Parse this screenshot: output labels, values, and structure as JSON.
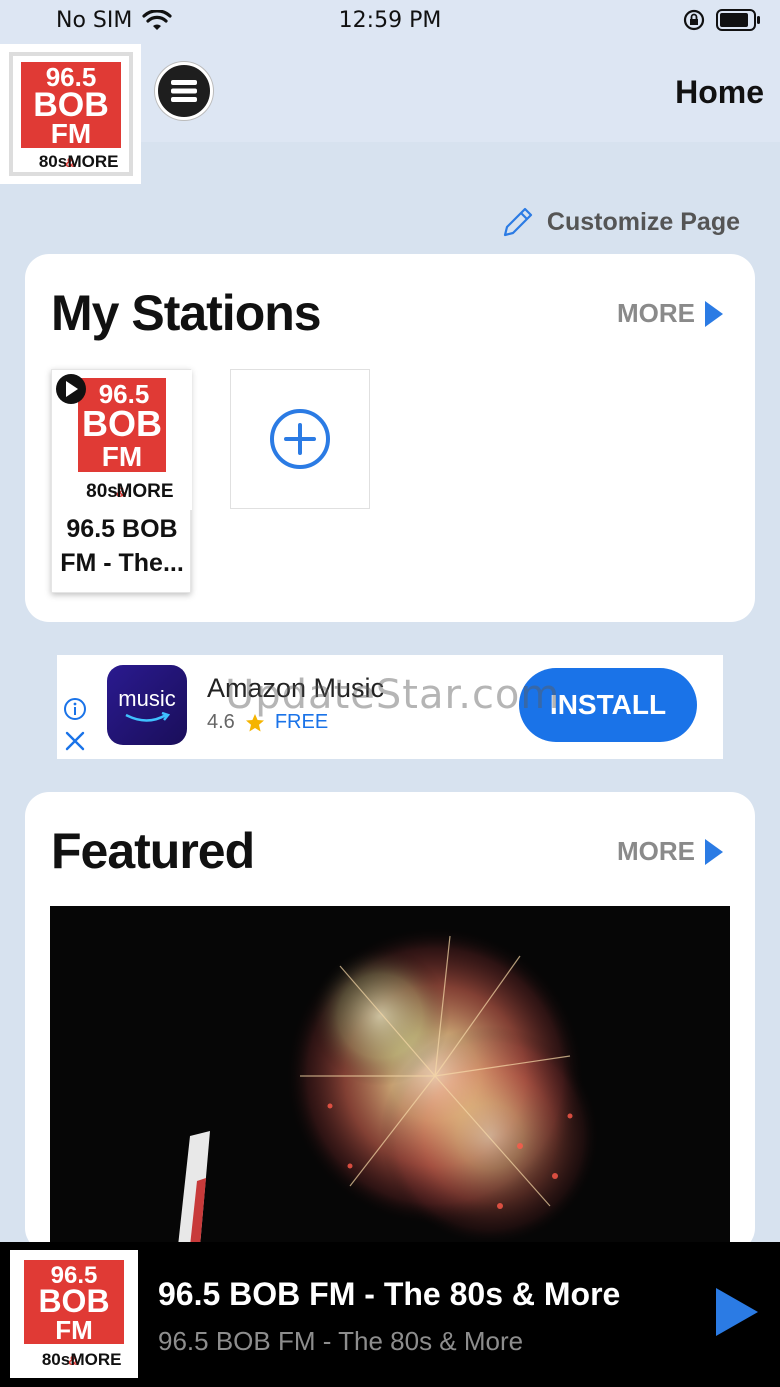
{
  "status_bar": {
    "carrier": "No SIM",
    "time": "12:59 PM"
  },
  "header": {
    "title": "Home",
    "logo": {
      "line1": "96.5",
      "line2": "BOB",
      "line3": "FM",
      "line4": "80s",
      "line4b": "&",
      "line4c": "MORE"
    }
  },
  "customize_label": "Customize Page",
  "my_stations": {
    "title": "My Stations",
    "more_label": "MORE",
    "stations": [
      {
        "name_line1": "96.5 BOB",
        "name_line2": "FM - The..."
      }
    ]
  },
  "ad": {
    "app_icon_label": "music",
    "app_name": "Amazon Music",
    "rating": "4.6",
    "price": "FREE",
    "install_label": "INSTALL",
    "watermark": "UpdateStar.com"
  },
  "featured": {
    "title": "Featured",
    "more_label": "MORE"
  },
  "player": {
    "title": "96.5 BOB FM - The 80s & More",
    "subtitle": "96.5 BOB FM - The 80s & More"
  },
  "colors": {
    "accent": "#2b7be4",
    "logo_red": "#e03a35",
    "background": "#dde6f3"
  }
}
